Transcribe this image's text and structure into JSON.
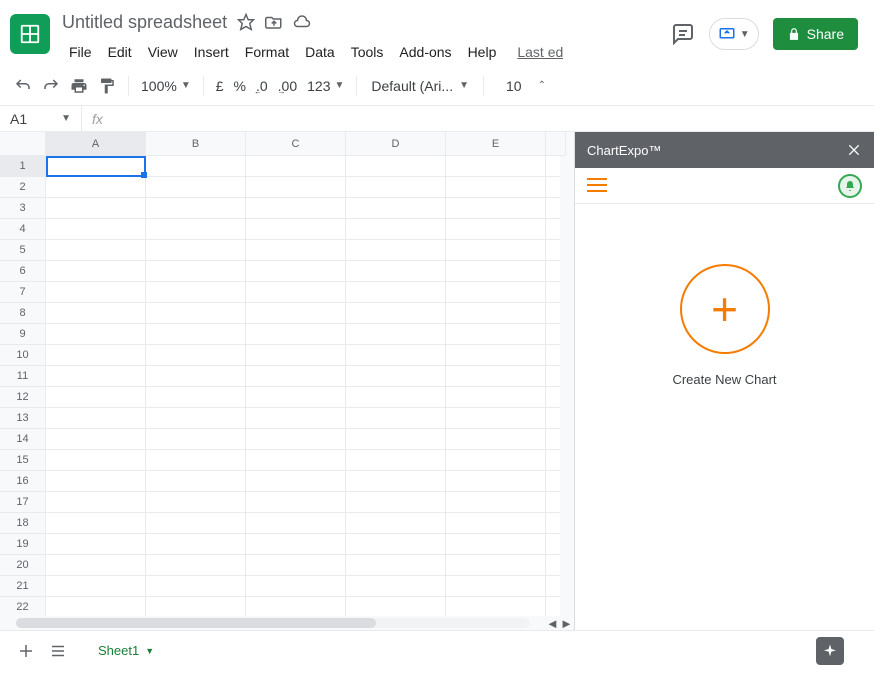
{
  "header": {
    "doc_title": "Untitled spreadsheet",
    "menu": [
      "File",
      "Edit",
      "View",
      "Insert",
      "Format",
      "Data",
      "Tools",
      "Add-ons",
      "Help"
    ],
    "last_edit": "Last ed",
    "share_label": "Share"
  },
  "toolbar": {
    "zoom": "100%",
    "currency": "£",
    "percent": "%",
    "dec_decrease": ".0",
    "dec_increase": ".00",
    "number_format": "123",
    "font": "Default (Ari...",
    "font_size": "10"
  },
  "formula_bar": {
    "name_box": "A1",
    "fx": "fx"
  },
  "grid": {
    "columns": [
      "A",
      "B",
      "C",
      "D",
      "E"
    ],
    "rows": [
      "1",
      "2",
      "3",
      "4",
      "5",
      "6",
      "7",
      "8",
      "9",
      "10",
      "11",
      "12",
      "13",
      "14",
      "15",
      "16",
      "17",
      "18",
      "19",
      "20",
      "21",
      "22"
    ],
    "active_cell": "A1"
  },
  "sidebar": {
    "title": "ChartExpo™",
    "create_label": "Create New Chart"
  },
  "footer": {
    "sheet_name": "Sheet1"
  }
}
